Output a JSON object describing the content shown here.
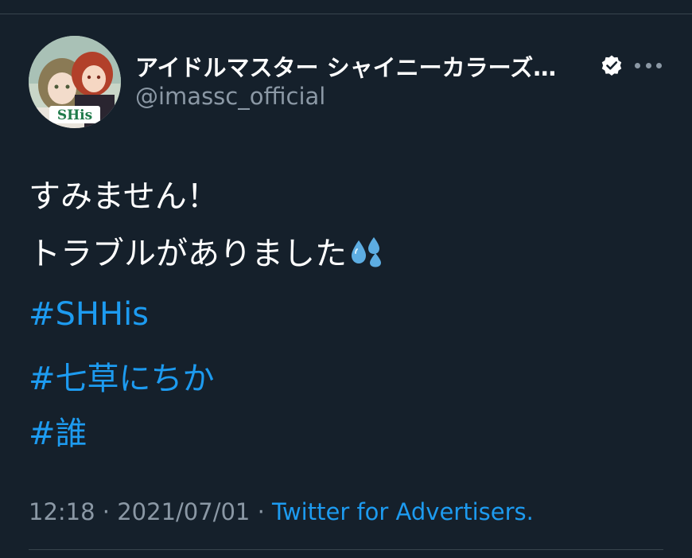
{
  "tweet": {
    "author": {
      "display_name": "アイドルマスター シャイニーカラーズ…",
      "handle": "@imassc_official",
      "avatar_logo_text": "SHis",
      "verified": true
    },
    "text_lines": [
      "すみません！",
      "トラブルがありました"
    ],
    "emoji": "sweat-droplets",
    "hashtags": [
      "#SHHis",
      "#七草にちか",
      "#誰"
    ],
    "time": "12:18",
    "date": "2021/07/01",
    "separator": "·",
    "source": "Twitter for Advertisers."
  },
  "colors": {
    "background": "#15202b",
    "text_primary": "#ffffff",
    "text_secondary": "#8b98a5",
    "link": "#1d9bf0",
    "divider": "#38444d"
  }
}
